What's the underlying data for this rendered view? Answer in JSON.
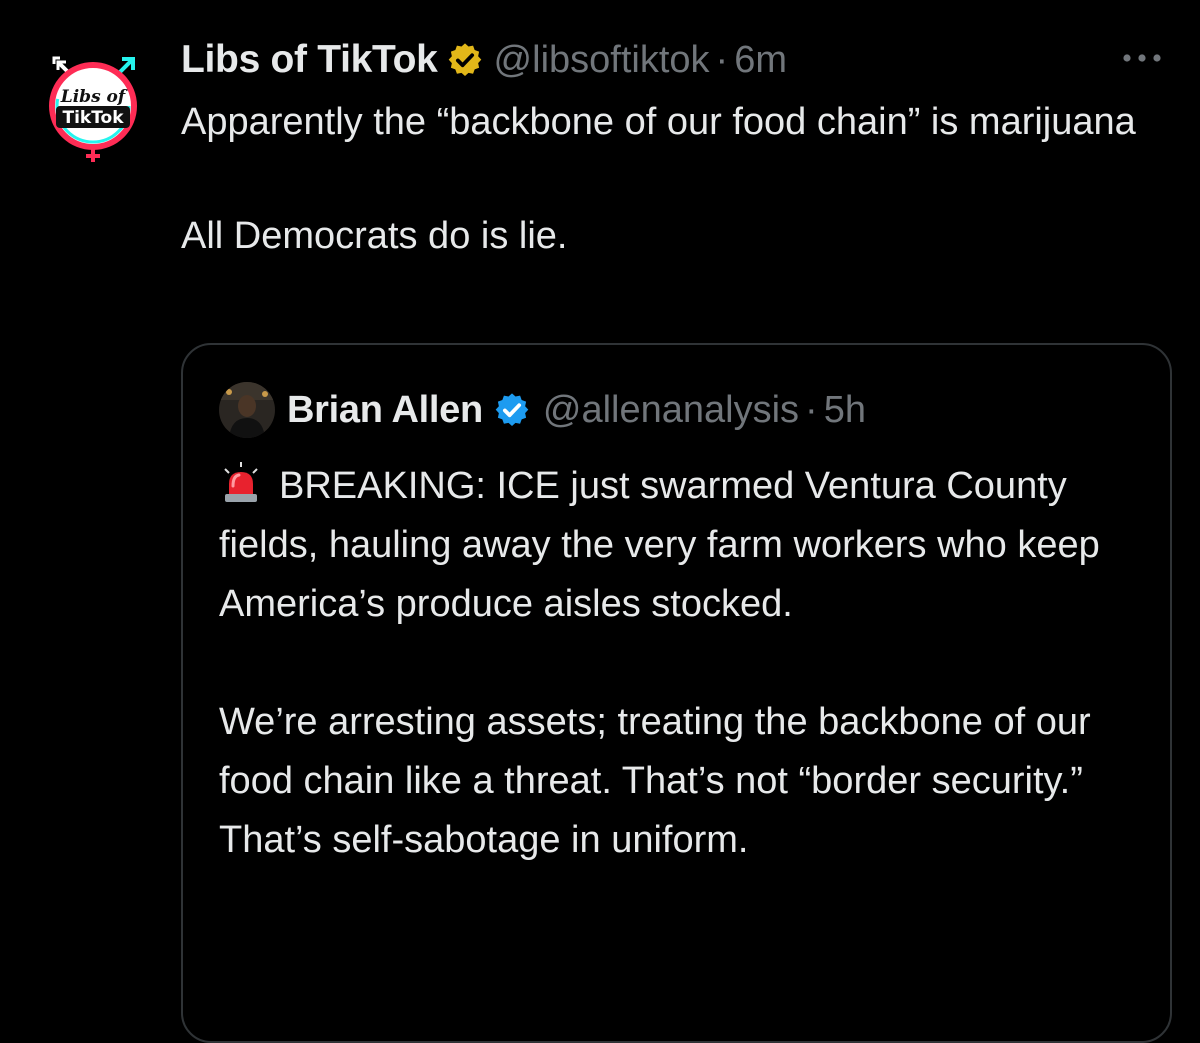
{
  "tweet": {
    "display_name": "Libs of TikTok",
    "handle": "@libsoftiktok",
    "separator": "·",
    "time": "6m",
    "avatar_logo_text_line1": "Libs of",
    "avatar_logo_text_line2": "TikTok",
    "text_paragraphs": [
      "Apparently the “backbone of our food chain” is marijuana",
      "All Democrats do is lie."
    ],
    "verified_badge_color": "#e2b719"
  },
  "quoted_tweet": {
    "display_name": "Brian Allen",
    "handle": "@allenanalysis",
    "separator": "·",
    "time": "5h",
    "verified_badge_color": "#1d9bf0",
    "emoji_icon": "police-light-icon",
    "text_paragraphs": [
      "BREAKING: ICE just swarmed Ventura County fields, hauling away the very farm workers who keep America’s produce aisles stocked.",
      "We’re arresting assets; treating the backbone of our food chain like a threat. That’s not “border security.” That’s self-sabotage in uniform."
    ]
  },
  "colors": {
    "background": "#000000",
    "primary_text": "#e7e9ea",
    "secondary_text": "#71767b",
    "border": "#2f3336"
  }
}
